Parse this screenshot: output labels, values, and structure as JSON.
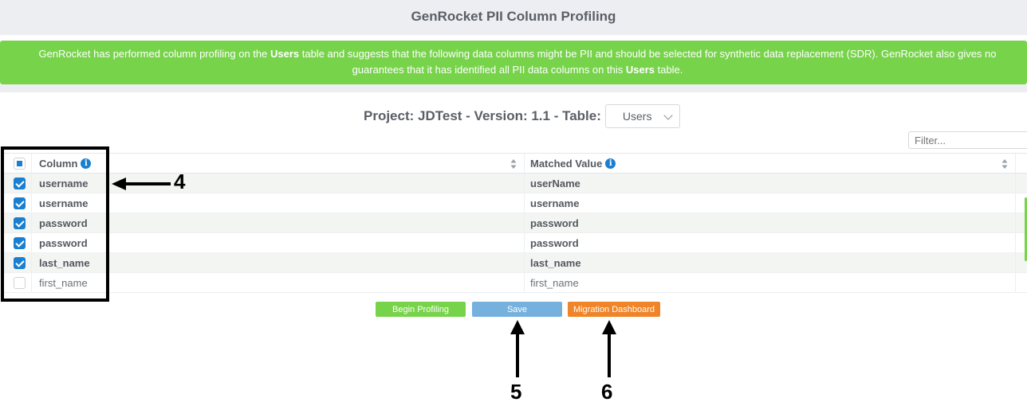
{
  "header": {
    "title": "GenRocket PII Column Profiling"
  },
  "alert": {
    "part1": "GenRocket has performed column profiling on the ",
    "table1": "Users",
    "part2": " table and suggests that the following data columns might be PII and should be selected for synthetic data replacement (SDR). GenRocket also gives no",
    "part3": "guarantees that it has identified all PII data columns on this ",
    "table2": "Users",
    "part4": " table."
  },
  "project": {
    "label": "Project: JDTest - Version: 1.1 - Table:",
    "table_selected": "Users"
  },
  "filter": {
    "placeholder": "Filter..."
  },
  "grid": {
    "headers": {
      "column": "Column",
      "matched": "Matched Value"
    },
    "rows": [
      {
        "column": "username",
        "matched": "userName",
        "checked": true
      },
      {
        "column": "username",
        "matched": "username",
        "checked": true
      },
      {
        "column": "password",
        "matched": "password",
        "checked": true
      },
      {
        "column": "password",
        "matched": "password",
        "checked": true
      },
      {
        "column": "last_name",
        "matched": "last_name",
        "checked": true
      },
      {
        "column": "first_name",
        "matched": "first_name",
        "checked": false
      }
    ]
  },
  "buttons": {
    "begin": "Begin Profiling",
    "save": "Save",
    "migration": "Migration Dashboard"
  },
  "annotations": {
    "n4": "4",
    "n5": "5",
    "n6": "6"
  },
  "colors": {
    "accent": "#1a7fd0",
    "success": "#77d34a",
    "save": "#76b1de",
    "migration": "#ef8428"
  },
  "icons": {
    "info": "info-icon",
    "sort": "sort-icon",
    "chevron": "chevron-down-icon"
  }
}
